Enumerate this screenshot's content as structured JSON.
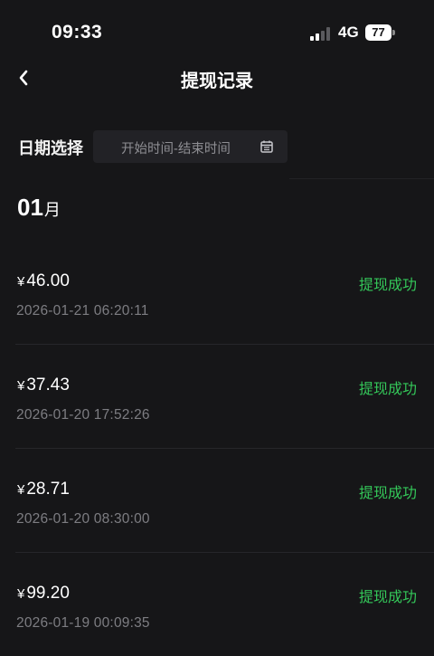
{
  "status_bar": {
    "time": "09:33",
    "network": "4G",
    "battery": "77"
  },
  "nav": {
    "title": "提现记录"
  },
  "filter": {
    "label": "日期选择",
    "placeholder": "开始时间-结束时间"
  },
  "month": {
    "number": "01",
    "unit": "月"
  },
  "records": [
    {
      "currency": "¥",
      "amount": "46.00",
      "datetime": "2026-01-21 06:20:11",
      "status": "提现成功"
    },
    {
      "currency": "¥",
      "amount": "37.43",
      "datetime": "2026-01-20 17:52:26",
      "status": "提现成功"
    },
    {
      "currency": "¥",
      "amount": "28.71",
      "datetime": "2026-01-20 08:30:00",
      "status": "提现成功"
    },
    {
      "currency": "¥",
      "amount": "99.20",
      "datetime": "2026-01-19 00:09:35",
      "status": "提现成功"
    }
  ],
  "colors": {
    "background": "#161618",
    "success": "#34c759",
    "muted_text": "#7d7d82",
    "picker_bg": "#222226"
  },
  "icons": {
    "back": "chevron-left-icon",
    "calendar": "calendar-icon"
  }
}
